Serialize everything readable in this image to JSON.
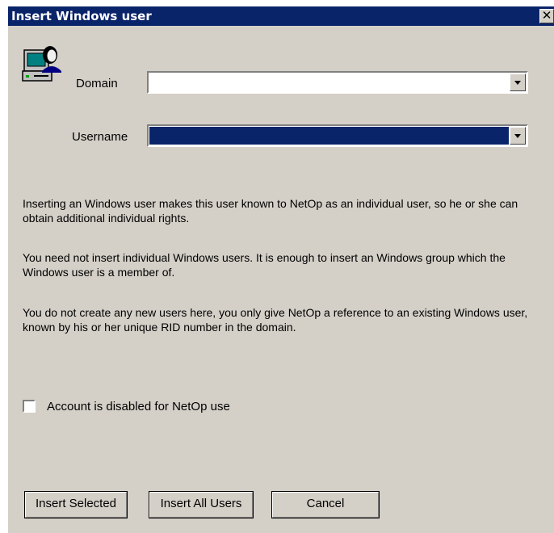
{
  "window": {
    "title": "Insert Windows user",
    "close_glyph": "✕"
  },
  "form": {
    "domain_label": "Domain",
    "domain_value": "",
    "username_label": "Username",
    "username_value": ""
  },
  "info": {
    "para1": "Inserting an Windows user makes this user known to NetOp as an individual user, so he or she can obtain additional individual rights.",
    "para2": "You need not insert individual Windows users. It is enough to insert an Windows group which the Windows user is a member of.",
    "para3": "You do not create any new users here, you only give NetOp a reference to an existing Windows user, known by his or her unique RID number in the domain."
  },
  "checkbox": {
    "label": "Account is disabled for NetOp use",
    "checked": false
  },
  "buttons": {
    "insert_selected": "Insert Selected",
    "insert_all": "Insert All Users",
    "cancel": "Cancel"
  },
  "colors": {
    "title_bar": "#0a246a",
    "dialog_bg": "#d4d0c8",
    "selection": "#0a246a"
  }
}
